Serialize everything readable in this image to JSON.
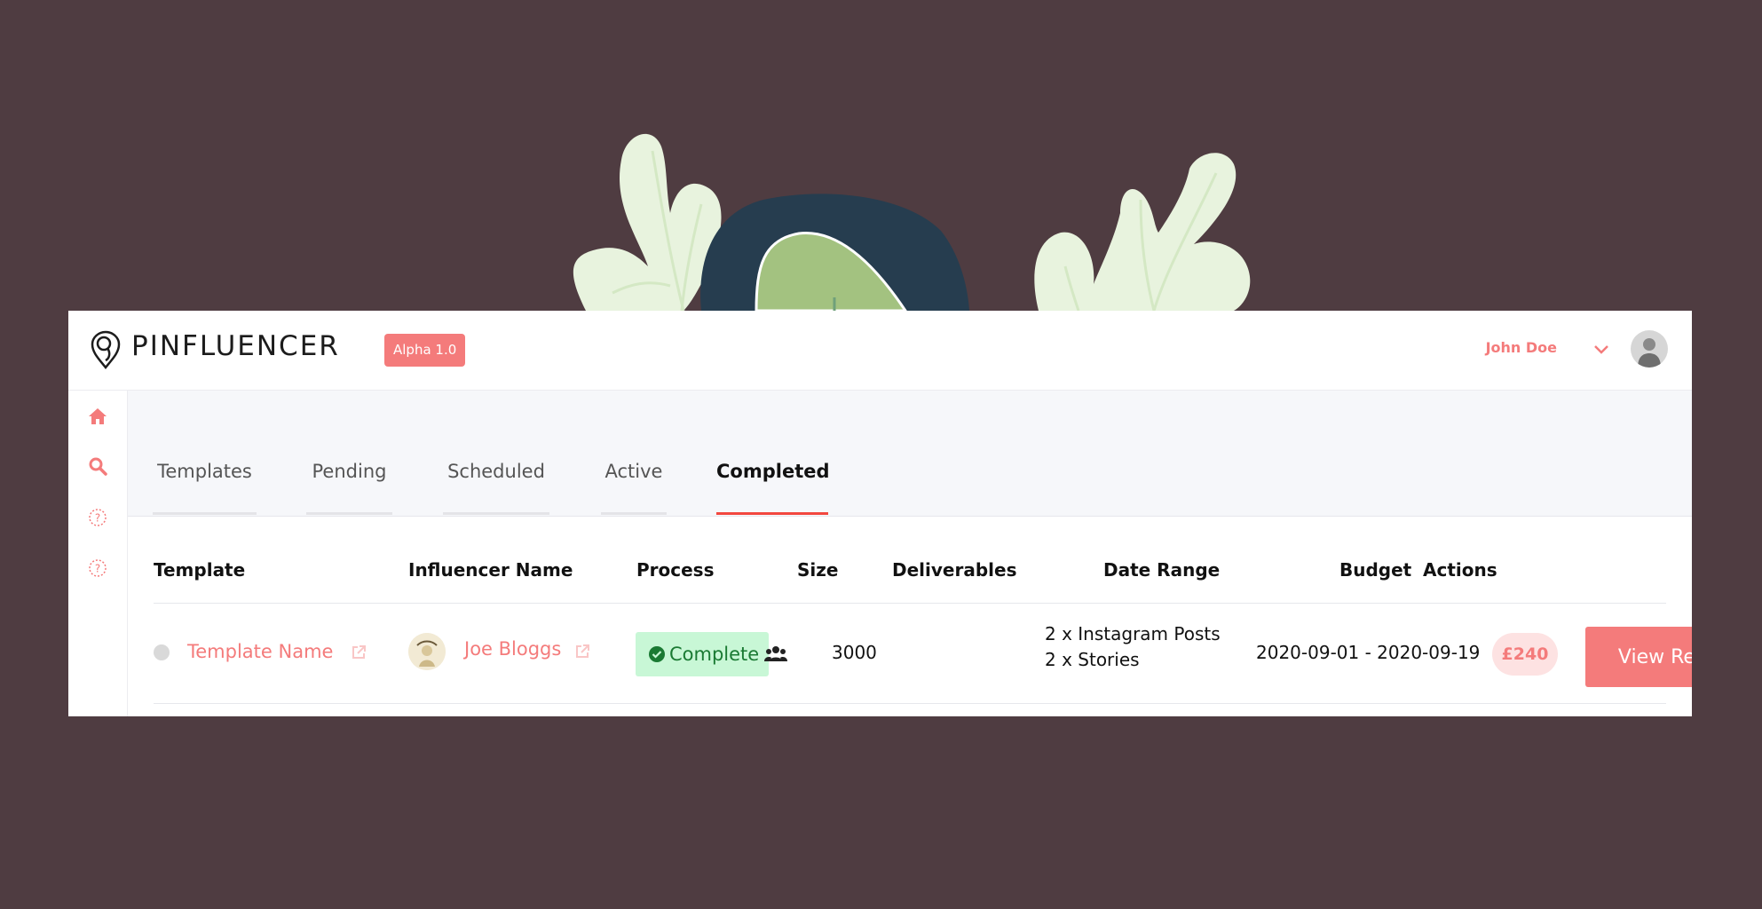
{
  "app": {
    "name": "PINFLUENCER",
    "version": "Alpha 1.0"
  },
  "user": {
    "name": "John Doe"
  },
  "sidebar": {
    "icons": [
      "home-icon",
      "search-icon",
      "help-icon",
      "help-icon"
    ]
  },
  "tabs": [
    {
      "label": "Templates"
    },
    {
      "label": "Pending"
    },
    {
      "label": "Scheduled"
    },
    {
      "label": "Active"
    },
    {
      "label": "Completed"
    }
  ],
  "active_tab": "Completed",
  "table": {
    "headers": [
      "Template",
      "Influencer Name",
      "Process",
      "Size",
      "Deliverables",
      "Date Range",
      "Budget",
      "Actions"
    ],
    "rows": [
      {
        "template": "Template Name",
        "influencer": "Joe Bloggs",
        "process": "Complete",
        "size": "3000",
        "deliverables": [
          "2 x Instagram Posts",
          "2 x Stories"
        ],
        "date_range": "2020-09-01 - 2020-09-19",
        "budget": "£240",
        "action": "View Report"
      }
    ]
  },
  "colors": {
    "background": "#4f3c41",
    "accent": "#f47b7b",
    "active_tab_underline": "#f2473f",
    "status_complete_bg": "#c8f7d6",
    "status_complete_text": "#1a7a33"
  }
}
